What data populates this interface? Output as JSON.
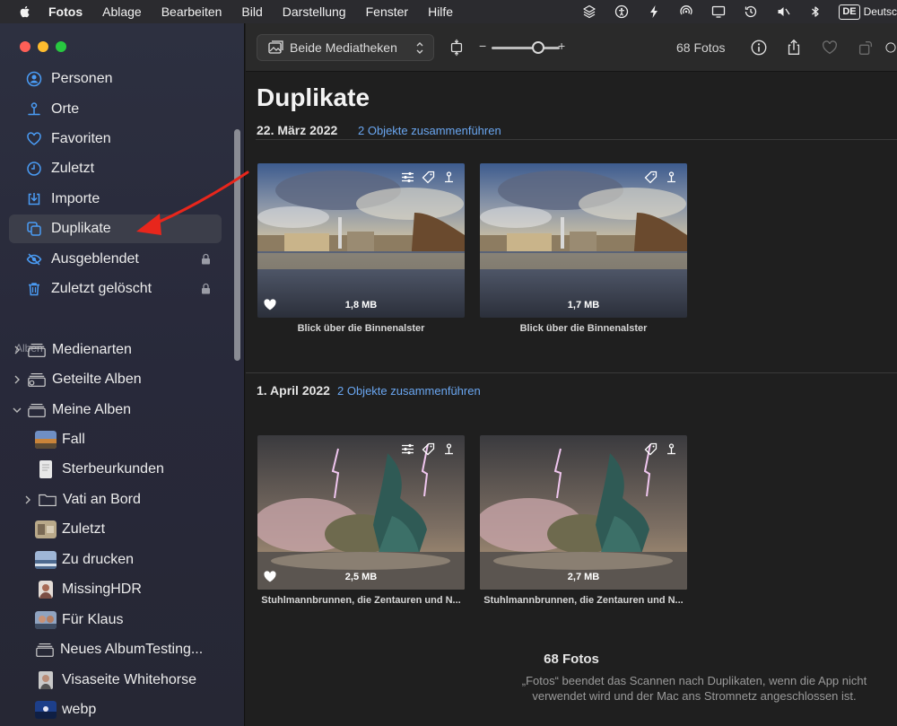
{
  "menubar": {
    "app_name": "Fotos",
    "items": [
      "Ablage",
      "Bearbeiten",
      "Bild",
      "Darstellung",
      "Fenster",
      "Hilfe"
    ],
    "status_icons": [
      "stack-icon",
      "accessibility-icon",
      "bolt-icon",
      "airdrop-icon",
      "display-icon",
      "time-machine-icon",
      "mute-icon",
      "bluetooth-icon"
    ],
    "input_source": "DE",
    "input_source_name": "Deutsc"
  },
  "sidebar": {
    "items": [
      {
        "label": "Personen",
        "icon": "person-icon"
      },
      {
        "label": "Orte",
        "icon": "pin-icon"
      },
      {
        "label": "Favoriten",
        "icon": "heart-icon"
      },
      {
        "label": "Zuletzt",
        "icon": "clock-icon"
      },
      {
        "label": "Importe",
        "icon": "import-icon"
      },
      {
        "label": "Duplikate",
        "icon": "duplicate-icon",
        "selected": true
      },
      {
        "label": "Ausgeblendet",
        "icon": "eye-slash-icon",
        "locked": true
      },
      {
        "label": "Zuletzt gelöscht",
        "icon": "trash-icon",
        "locked": true
      }
    ],
    "section_title": "Alben",
    "album_groups": [
      {
        "label": "Medienarten",
        "expanded": false
      },
      {
        "label": "Geteilte Alben",
        "expanded": false
      },
      {
        "label": "Meine Alben",
        "expanded": true
      }
    ],
    "albums": [
      {
        "label": "Fall"
      },
      {
        "label": "Sterbeurkunden"
      },
      {
        "label": "Vati an Bord",
        "folder": true
      },
      {
        "label": "Zuletzt"
      },
      {
        "label": "Zu drucken"
      },
      {
        "label": "MissingHDR"
      },
      {
        "label": "Für Klaus"
      },
      {
        "label": "Neues AlbumTesting..."
      },
      {
        "label": "Visaseite Whitehorse"
      },
      {
        "label": "webp"
      }
    ]
  },
  "toolbar": {
    "library_select": "Beide Mediatheken",
    "zoom_minus": "−",
    "zoom_plus": "+",
    "zoom_level": 0.68,
    "count": "68 Fotos"
  },
  "main": {
    "title": "Duplikate",
    "groups": [
      {
        "date": "22. März 2022",
        "merge_label": "2 Objekte zusammenführen",
        "photos": [
          {
            "size": "1,8 MB",
            "caption": "Blick über die Binnenalster",
            "favorite": true,
            "edited": true
          },
          {
            "size": "1,7 MB",
            "caption": "Blick über die Binnenalster",
            "favorite": false,
            "edited": false
          }
        ]
      },
      {
        "date": "1. April 2022",
        "merge_label": "2 Objekte zusammenführen",
        "photos": [
          {
            "size": "2,5 MB",
            "caption": "Stuhlmannbrunnen, die Zentauren und N...",
            "favorite": true,
            "edited": true
          },
          {
            "size": "2,7 MB",
            "caption": "Stuhlmannbrunnen, die Zentauren und N...",
            "favorite": false,
            "edited": false
          }
        ]
      }
    ],
    "footer_count": "68 Fotos",
    "footer_note": "„Fotos“ beendet das Scannen nach Duplikaten, wenn die App nicht verwendet wird und der Mac ans Stromnetz angeschlossen ist."
  },
  "colors": {
    "accent_link": "#6aa6f0",
    "annotation_arrow": "#e8261c",
    "sidebar_icon": "#4a9cf5"
  }
}
